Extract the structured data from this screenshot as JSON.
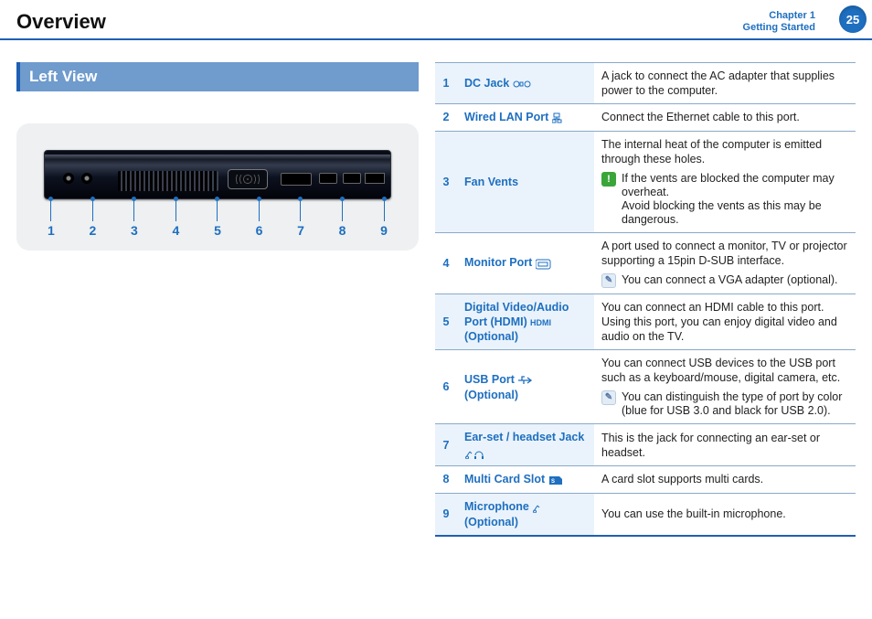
{
  "header": {
    "title": "Overview",
    "chapter_line1": "Chapter 1",
    "chapter_line2": "Getting Started",
    "page_number": "25"
  },
  "left": {
    "section_title": "Left View",
    "callouts": [
      "1",
      "2",
      "3",
      "4",
      "5",
      "6",
      "7",
      "8",
      "9"
    ]
  },
  "rows": [
    {
      "num": "1",
      "label": "DC Jack",
      "icon": "dc-jack-icon",
      "desc": "A jack to connect the AC adapter that supplies power to the computer."
    },
    {
      "num": "2",
      "label": "Wired LAN Port",
      "icon": "lan-icon",
      "desc": "Connect the Ethernet cable to this port."
    },
    {
      "num": "3",
      "label": "Fan Vents",
      "icon": "",
      "desc": "The internal heat of the computer is emitted through these holes.",
      "warn": "If the vents are blocked the computer may overheat.\nAvoid blocking the vents as this may be dangerous."
    },
    {
      "num": "4",
      "label": "Monitor Port",
      "icon": "monitor-icon",
      "desc": "A port used to connect a monitor, TV or projector supporting a 15pin D-SUB interface.",
      "tip": "You can connect a VGA adapter (optional)."
    },
    {
      "num": "5",
      "label": "Digital Video/Audio Port (HDMI)",
      "suffix": "(Optional)",
      "icon": "hdmi-icon",
      "desc": "You can connect an HDMI cable to this port. Using this port, you can enjoy digital video and audio on the TV."
    },
    {
      "num": "6",
      "label": "USB Port",
      "suffix": "(Optional)",
      "icon": "usb-icon",
      "desc": "You can connect USB devices to the USB port such as a keyboard/mouse, digital camera, etc.",
      "tip": "You can distinguish the type of port by color (blue for USB 3.0 and black for USB 2.0)."
    },
    {
      "num": "7",
      "label": "Ear-set / headset Jack",
      "icon": "headset-icon",
      "desc": "This is the jack for connecting an ear-set or headset."
    },
    {
      "num": "8",
      "label": "Multi Card Slot",
      "icon": "sdcard-icon",
      "desc": "A card slot supports multi cards."
    },
    {
      "num": "9",
      "label": "Microphone",
      "suffix": "(Optional)",
      "icon": "mic-icon",
      "desc": "You can use the built-in microphone."
    }
  ]
}
